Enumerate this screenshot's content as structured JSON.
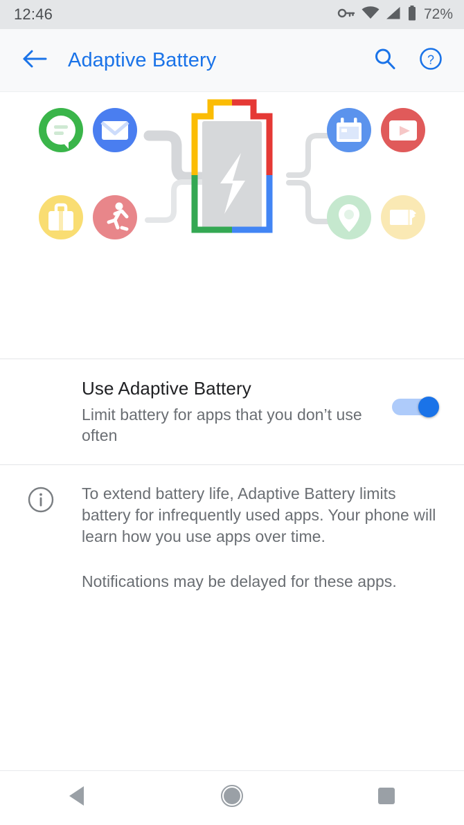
{
  "status_bar": {
    "time": "12:46",
    "battery_percent": "72%",
    "icons": [
      "vpn-key-icon",
      "wifi-icon",
      "cell-signal-icon",
      "battery-icon"
    ]
  },
  "app_bar": {
    "back_label": "back-arrow",
    "title": "Adaptive Battery",
    "search_label": "search",
    "help_label": "help",
    "accent_color": "#1a73e8"
  },
  "illustration": {
    "name": "adaptive-battery-illustration",
    "battery_colors": {
      "red": "#e53935",
      "yellow": "#fbbc04",
      "green": "#34a853",
      "blue": "#4285f4",
      "fill": "#d6d8da",
      "bolt": "#ffffff"
    },
    "apps": [
      {
        "name": "messages-app-icon",
        "circle": "#3ab54a",
        "glyph": "chat-bubble",
        "faded": false
      },
      {
        "name": "mail-app-icon",
        "circle": "#4a7ef0",
        "glyph": "envelope",
        "faded": false
      },
      {
        "name": "work-app-icon",
        "circle": "#f9dd72",
        "glyph": "briefcase",
        "faded": true
      },
      {
        "name": "fitness-app-icon",
        "circle": "#e8868a",
        "glyph": "running-person",
        "faded": true
      },
      {
        "name": "calendar-app-icon",
        "circle": "#5b93ed",
        "glyph": "calendar",
        "faded": false
      },
      {
        "name": "video-app-icon",
        "circle": "#e05a5a",
        "glyph": "play-button",
        "faded": false
      },
      {
        "name": "maps-app-icon",
        "circle": "#c5e8ce",
        "glyph": "location-pin",
        "faded": true
      },
      {
        "name": "photos-app-icon",
        "circle": "#fae9b4",
        "glyph": "film-frame",
        "faded": true
      }
    ]
  },
  "setting": {
    "title": "Use Adaptive Battery",
    "summary": "Limit battery for apps that you don’t use often",
    "switch_state": "on",
    "switch_on_color": "#1a73e8",
    "switch_track_color": "#aecbfa"
  },
  "info": {
    "icon": "info-icon",
    "paragraph_1": "To extend battery life, Adaptive Battery limits battery for infrequently used apps. Your phone will learn how you use apps over time.",
    "paragraph_2": "Notifications may be delayed for these apps."
  },
  "nav_bar": {
    "back": "back-triangle",
    "home": "home-circle",
    "recents": "recents-square"
  }
}
